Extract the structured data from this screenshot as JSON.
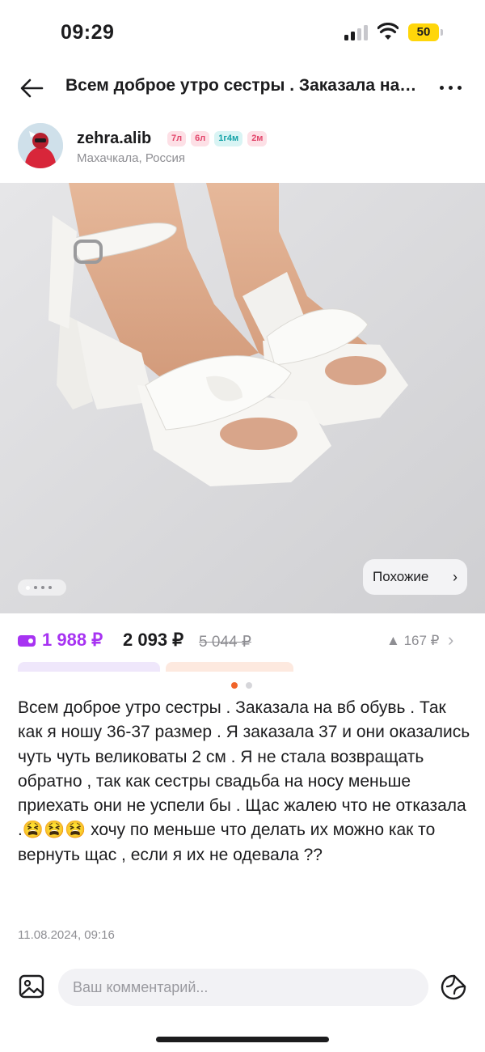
{
  "status_bar": {
    "time": "09:29",
    "battery": "50"
  },
  "header": {
    "title": "Всем доброе утро сестры . Заказала на вб обувь",
    "back_icon": "arrow-left-icon",
    "more_icon": "more-dots-icon"
  },
  "author": {
    "username": "zehra.alib",
    "badges": [
      "7л",
      "6л",
      "1г4м",
      "2м"
    ],
    "location": "Махачкала, Россия"
  },
  "photo": {
    "similar_label": "Похожие",
    "pager_count": 4,
    "pager_active": 1
  },
  "price": {
    "main": "1 988 ₽",
    "alt": "2 093 ₽",
    "old": "5 044 ₽",
    "delta": "167 ₽",
    "delta_icon": "triangle-up-icon"
  },
  "carousel": {
    "count": 2,
    "active": 1
  },
  "post": {
    "text_before": "Всем доброе утро сестры . Заказала на вб обувь . Так как я ношу 36-37 размер . Я заказала 37 и они оказались чуть чуть великоваты 2 см . Я не стала  возвращать обратно , так как сестры свадьба на носу меньше приехать они не успели бы . Щас жалею что не отказала .",
    "emoji": "😫😫😫",
    "text_after": " хочу по меньше что делать их можно как то вернуть щас , если я их не одевала ??",
    "date": "11.08.2024, 09:16"
  },
  "comment": {
    "placeholder": "Ваш комментарий..."
  },
  "colors": {
    "accent": "#a733f2",
    "carousel_active": "#f0642a",
    "muted": "#8e8e93"
  }
}
